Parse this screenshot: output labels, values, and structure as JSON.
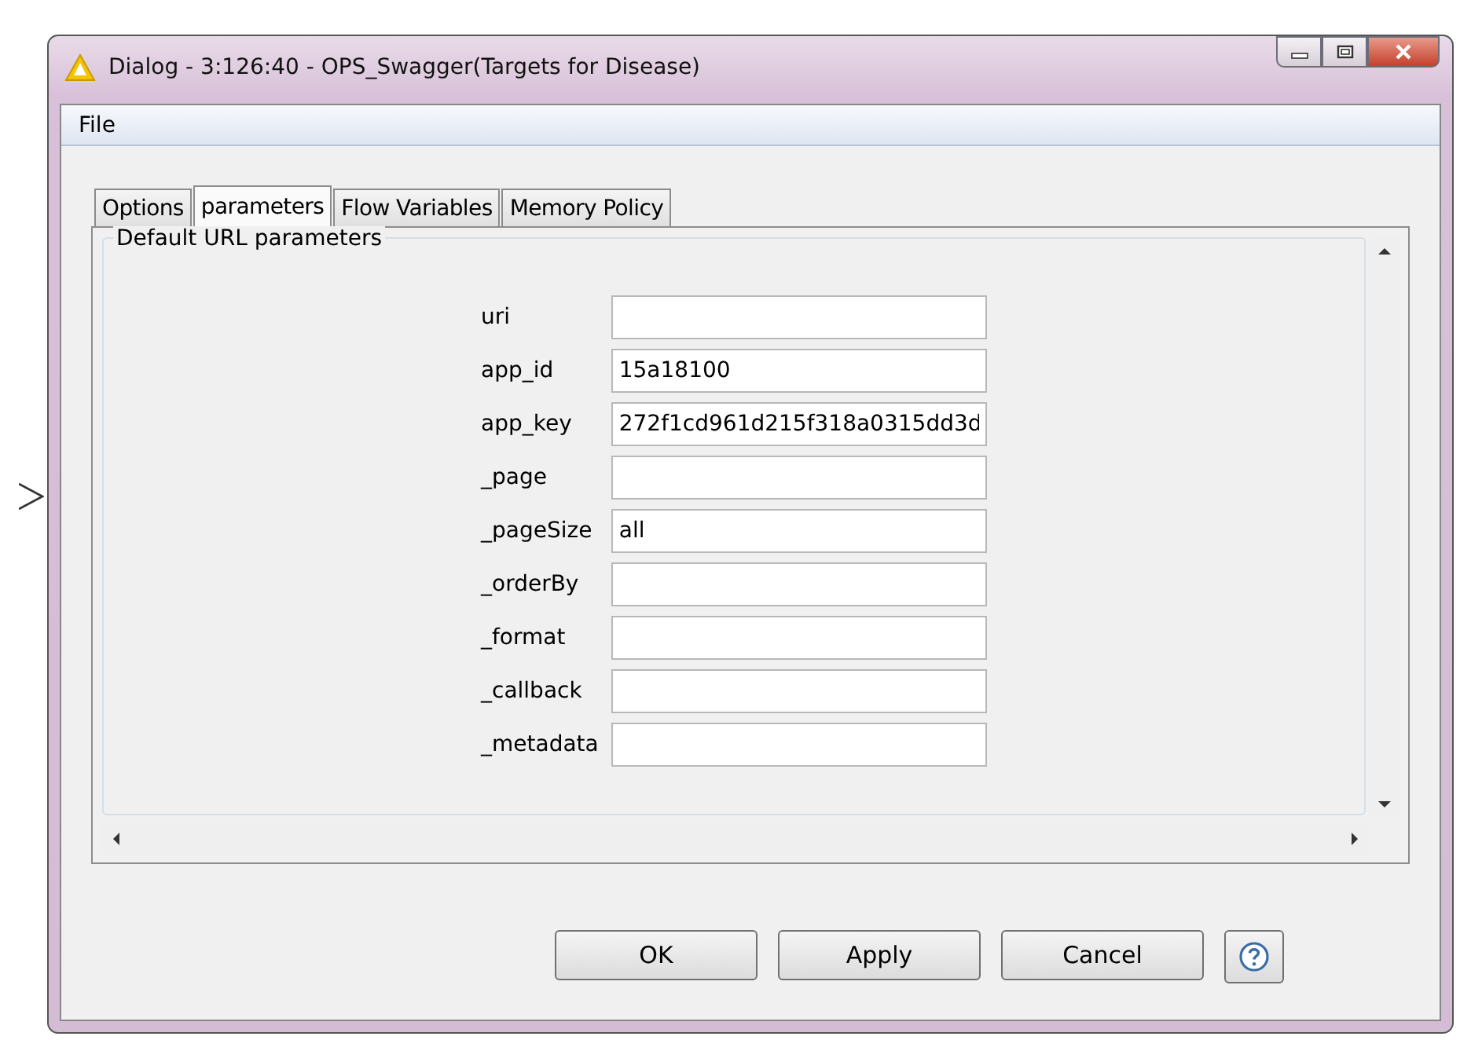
{
  "window": {
    "title": "Dialog - 3:126:40 - OPS_Swagger(Targets for Disease)"
  },
  "menu": [
    "File"
  ],
  "tabs": [
    {
      "label": "Options",
      "selected": false
    },
    {
      "label": "parameters",
      "selected": true
    },
    {
      "label": "Flow Variables",
      "selected": false
    },
    {
      "label": "Memory Policy",
      "selected": false
    }
  ],
  "group": {
    "title": "Default URL parameters",
    "fields": [
      {
        "label": "uri"
      },
      {
        "label": "app_id",
        "value": "15a18100"
      },
      {
        "label": "app_key",
        "value": "272f1cd961d215f318a0315dd3d"
      },
      {
        "label": "_page"
      },
      {
        "label": "_pageSize",
        "value": "all"
      },
      {
        "label": "_orderBy"
      },
      {
        "label": "_format"
      },
      {
        "label": "_callback"
      },
      {
        "label": "_metadata"
      }
    ]
  },
  "buttons": [
    "OK",
    "Apply",
    "Cancel"
  ]
}
